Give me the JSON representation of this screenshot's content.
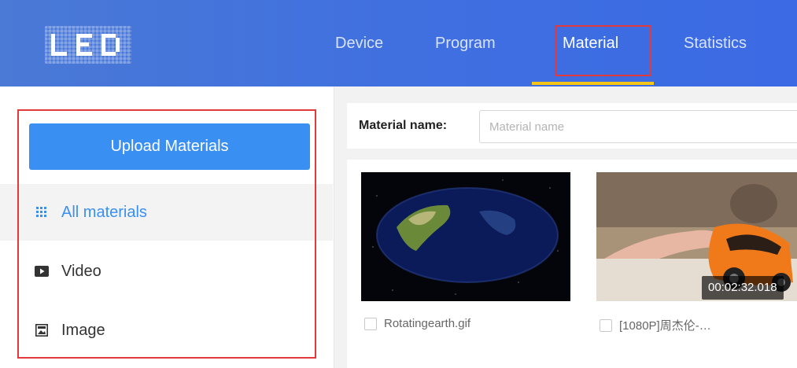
{
  "header": {
    "logo_text": "LED",
    "nav": [
      {
        "label": "Device"
      },
      {
        "label": "Program"
      },
      {
        "label": "Material"
      },
      {
        "label": "Statistics"
      }
    ],
    "active_nav": "Material",
    "accent_color": "#f5c518"
  },
  "sidebar": {
    "upload_label": "Upload Materials",
    "items": [
      {
        "label": "All materials",
        "icon": "grid-icon"
      },
      {
        "label": "Video",
        "icon": "video-icon"
      },
      {
        "label": "Image",
        "icon": "image-icon"
      }
    ],
    "active_item": "All materials"
  },
  "search": {
    "label": "Material name:",
    "placeholder": "Material name",
    "value": ""
  },
  "materials": [
    {
      "name": "Rotatingearth.gif",
      "duration": ""
    },
    {
      "name": "[1080P]周杰伦-…",
      "duration": "00:02:32.018"
    }
  ],
  "colors": {
    "header": "#3f6fe0",
    "primary": "#3a8ff2",
    "highlight_box": "#e23a3a"
  }
}
